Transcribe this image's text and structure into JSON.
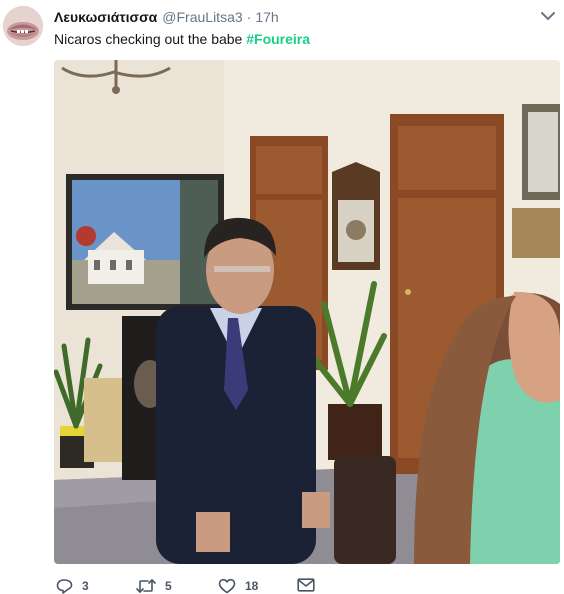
{
  "tweet": {
    "display_name": "Λευκωσιάτισσα",
    "handle": "@FrauLitsa3",
    "separator": "·",
    "time": "17h",
    "text": "Nicaros checking out the babe ",
    "hashtag": "#Foureira"
  },
  "actions": {
    "reply_count": "3",
    "retweet_count": "5",
    "like_count": "18"
  },
  "colors": {
    "hashtag": "#19cf86",
    "secondary_text": "#657786",
    "icon": "#4a5663"
  },
  "icons": [
    "chevron-down-icon",
    "reply-icon",
    "retweet-icon",
    "heart-icon",
    "envelope-icon"
  ]
}
